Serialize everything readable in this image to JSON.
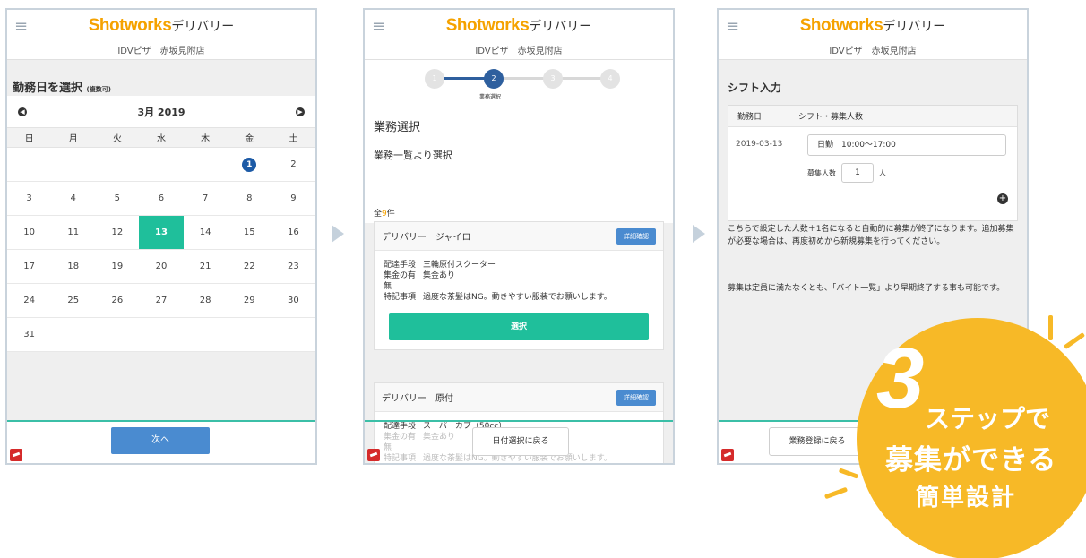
{
  "common": {
    "brand_logo": "Shotworks",
    "brand_sub": "デリバリー",
    "store": "IDVピザ　赤坂見附店"
  },
  "screen1": {
    "title": "勤務日を選択",
    "title_note": "(複数可)",
    "month": "3月 2019",
    "weekdays": [
      "日",
      "月",
      "火",
      "水",
      "木",
      "金",
      "土"
    ],
    "days": [
      "",
      "",
      "",
      "",
      "",
      "1",
      "2",
      "3",
      "4",
      "5",
      "6",
      "7",
      "8",
      "9",
      "10",
      "11",
      "12",
      "13",
      "14",
      "15",
      "16",
      "17",
      "18",
      "19",
      "20",
      "21",
      "22",
      "23",
      "24",
      "25",
      "26",
      "27",
      "28",
      "29",
      "30",
      "31",
      "",
      "",
      "",
      "",
      "",
      ""
    ],
    "next_button": "次へ"
  },
  "screen2": {
    "steps": [
      "1",
      "2",
      "3",
      "4"
    ],
    "active_step_label": "業務選択",
    "title": "業務選択",
    "subtitle": "業務一覧より選択",
    "count_prefix": "全",
    "count_num": "9",
    "count_suffix": "件",
    "card1": {
      "title": "デリバリー　ジャイロ",
      "detail_button": "詳細確認",
      "rows": [
        {
          "k": "配達手段",
          "v": "三輪原付スクーター"
        },
        {
          "k": "集金の有無",
          "v": "集金あり"
        },
        {
          "k": "特記事項",
          "v": "過度な茶髪はNG。動きやすい服装でお願いします。"
        }
      ],
      "select_button": "選択"
    },
    "card2": {
      "title": "デリバリー　原付",
      "detail_button": "詳細確認",
      "rows": [
        {
          "k": "配達手段",
          "v": "スーパーカブ（50cc）"
        },
        {
          "k": "集金の有無",
          "v": "集金あり"
        },
        {
          "k": "特記事項",
          "v": "過度な茶髪はNG。動きやすい服装でお願いします。"
        }
      ]
    },
    "back_button": "日付選択に戻る"
  },
  "screen3": {
    "title": "シフト入力",
    "col_date": "勤務日",
    "col_shift": "シフト・募集人数",
    "date": "2019-03-13",
    "shift_value": "日勤　10:00〜17:00",
    "count_label": "募集人数",
    "count_value": "1",
    "count_unit": "人",
    "note1": "こちらで設定した人数＋1名になると自動的に募集が終了になります。追加募集が必要な場合は、再度初めから新規募集を行ってください。",
    "note2": "募集は定員に満たなくとも、「バイト一覧」より早期終了する事も可能です。",
    "back_button": "業務登録に戻る"
  },
  "badge": {
    "number": "3",
    "line1": "ステップで",
    "line2": "募集ができる",
    "line3": "簡単設計"
  },
  "colors": {
    "brand_orange": "#f5a200",
    "teal": "#1fbf9b",
    "button_blue": "#4a8bd0",
    "navy": "#1c5aa6",
    "badge_yellow": "#f7b927"
  }
}
